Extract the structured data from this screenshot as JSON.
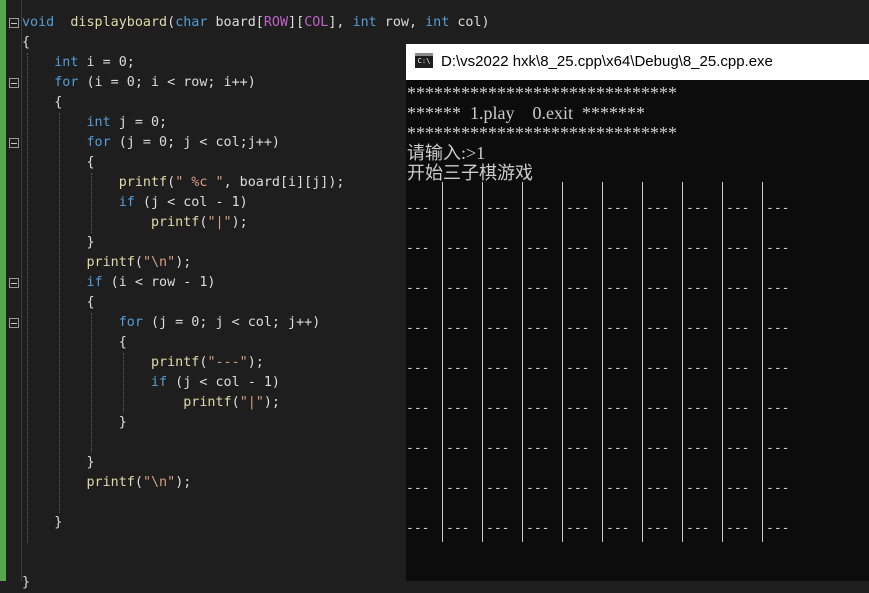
{
  "editor": {
    "lines": [
      [
        [
          "kw",
          "void"
        ],
        [
          "",
          "  "
        ],
        [
          "fn",
          "displayboard"
        ],
        [
          "",
          "("
        ],
        [
          "kw",
          "char"
        ],
        [
          "",
          " board["
        ],
        [
          "mac",
          "ROW"
        ],
        [
          "",
          "]["
        ],
        [
          "mac",
          "COL"
        ],
        [
          "",
          "], "
        ],
        [
          "kw",
          "int"
        ],
        [
          "",
          " row, "
        ],
        [
          "kw",
          "int"
        ],
        [
          "",
          " col)"
        ]
      ],
      [
        [
          "",
          "{"
        ]
      ],
      [
        [
          "",
          "    "
        ],
        [
          "kw",
          "int"
        ],
        [
          "",
          " i = 0;"
        ]
      ],
      [
        [
          "",
          "    "
        ],
        [
          "kw",
          "for"
        ],
        [
          "",
          " (i = 0; i < row; i++)"
        ]
      ],
      [
        [
          "",
          "    {"
        ]
      ],
      [
        [
          "",
          "        "
        ],
        [
          "kw",
          "int"
        ],
        [
          "",
          " j = 0;"
        ]
      ],
      [
        [
          "",
          "        "
        ],
        [
          "kw",
          "for"
        ],
        [
          "",
          " (j = 0; j < col;j++)"
        ]
      ],
      [
        [
          "",
          "        {"
        ]
      ],
      [
        [
          "",
          "            "
        ],
        [
          "fn",
          "printf"
        ],
        [
          "",
          "("
        ],
        [
          "str",
          "\" %c \""
        ],
        [
          "",
          ", board[i][j]);"
        ]
      ],
      [
        [
          "",
          "            "
        ],
        [
          "kw",
          "if"
        ],
        [
          "",
          " (j < col - 1)"
        ]
      ],
      [
        [
          "",
          "                "
        ],
        [
          "fn",
          "printf"
        ],
        [
          "",
          "("
        ],
        [
          "str",
          "\"|\""
        ],
        [
          "",
          ");"
        ]
      ],
      [
        [
          "",
          "        }"
        ]
      ],
      [
        [
          "",
          "        "
        ],
        [
          "fn",
          "printf"
        ],
        [
          "",
          "("
        ],
        [
          "str",
          "\"\\n\""
        ],
        [
          "",
          ");"
        ]
      ],
      [
        [
          "",
          "        "
        ],
        [
          "kw",
          "if"
        ],
        [
          "",
          " (i < row - 1)"
        ]
      ],
      [
        [
          "",
          "        {"
        ]
      ],
      [
        [
          "",
          "            "
        ],
        [
          "kw",
          "for"
        ],
        [
          "",
          " (j = 0; j < col; j++)"
        ]
      ],
      [
        [
          "",
          "            {"
        ]
      ],
      [
        [
          "",
          "                "
        ],
        [
          "fn",
          "printf"
        ],
        [
          "",
          "("
        ],
        [
          "str",
          "\"---\""
        ],
        [
          "",
          ");"
        ]
      ],
      [
        [
          "",
          "                "
        ],
        [
          "kw",
          "if"
        ],
        [
          "",
          " (j < col - 1)"
        ]
      ],
      [
        [
          "",
          "                    "
        ],
        [
          "fn",
          "printf"
        ],
        [
          "",
          "("
        ],
        [
          "str",
          "\"|\""
        ],
        [
          "",
          ");"
        ]
      ],
      [
        [
          "",
          "            }"
        ]
      ],
      [
        [
          "",
          ""
        ]
      ],
      [
        [
          "",
          "        }"
        ]
      ],
      [
        [
          "",
          "        "
        ],
        [
          "fn",
          "printf"
        ],
        [
          "",
          "("
        ],
        [
          "str",
          "\"\\n\""
        ],
        [
          "",
          ");"
        ]
      ],
      [
        [
          "",
          ""
        ]
      ],
      [
        [
          "",
          "    }"
        ]
      ],
      [
        [
          "",
          ""
        ]
      ],
      [
        [
          "",
          ""
        ]
      ],
      [
        [
          "",
          "}"
        ]
      ]
    ],
    "fold_lines": [
      0,
      3,
      6,
      13,
      15
    ]
  },
  "console": {
    "title": "D:\\vs2022 hxk\\8_25.cpp\\x64\\Debug\\8_25.cpp.exe",
    "icon_label": "C:\\",
    "lines": [
      "******************************",
      "******  1.play    0.exit  *******",
      "******************************",
      "请输入:>1",
      "开始三子棋游戏"
    ],
    "board": {
      "rows": 9,
      "cols": 10,
      "cell_text": "---"
    }
  }
}
